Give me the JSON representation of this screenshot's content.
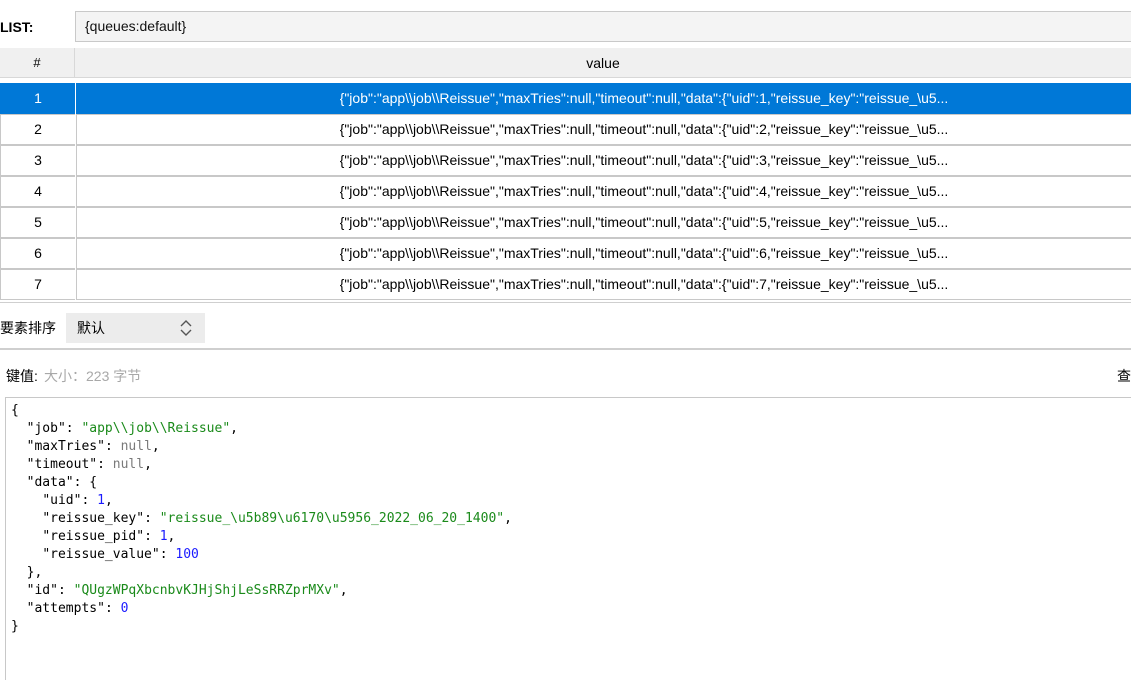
{
  "key_bar": {
    "label": "LIST:",
    "value": "{queues:default}"
  },
  "table": {
    "columns": [
      "#",
      "value"
    ],
    "rows": [
      {
        "index": "1",
        "value": "{\"job\":\"app\\\\job\\\\Reissue\",\"maxTries\":null,\"timeout\":null,\"data\":{\"uid\":1,\"reissue_key\":\"reissue_\\u5...",
        "selected": true
      },
      {
        "index": "2",
        "value": "{\"job\":\"app\\\\job\\\\Reissue\",\"maxTries\":null,\"timeout\":null,\"data\":{\"uid\":2,\"reissue_key\":\"reissue_\\u5..."
      },
      {
        "index": "3",
        "value": "{\"job\":\"app\\\\job\\\\Reissue\",\"maxTries\":null,\"timeout\":null,\"data\":{\"uid\":3,\"reissue_key\":\"reissue_\\u5..."
      },
      {
        "index": "4",
        "value": "{\"job\":\"app\\\\job\\\\Reissue\",\"maxTries\":null,\"timeout\":null,\"data\":{\"uid\":4,\"reissue_key\":\"reissue_\\u5..."
      },
      {
        "index": "5",
        "value": "{\"job\":\"app\\\\job\\\\Reissue\",\"maxTries\":null,\"timeout\":null,\"data\":{\"uid\":5,\"reissue_key\":\"reissue_\\u5..."
      },
      {
        "index": "6",
        "value": "{\"job\":\"app\\\\job\\\\Reissue\",\"maxTries\":null,\"timeout\":null,\"data\":{\"uid\":6,\"reissue_key\":\"reissue_\\u5..."
      },
      {
        "index": "7",
        "value": "{\"job\":\"app\\\\job\\\\Reissue\",\"maxTries\":null,\"timeout\":null,\"data\":{\"uid\":7,\"reissue_key\":\"reissue_\\u5..."
      }
    ],
    "selection_color": "#0078d7"
  },
  "sort": {
    "label": "要素排序",
    "selected": "默认",
    "icon": "chevron-up-down-icon"
  },
  "value_header": {
    "label": "键值:",
    "size": "大小：223 字节",
    "view_label": "查"
  },
  "json_view": {
    "open_brace": "{",
    "close_brace": "}",
    "job_key": "\"job\"",
    "job_value": "\"app\\\\job\\\\Reissue\"",
    "maxTries_key": "\"maxTries\"",
    "maxTries_value": "null",
    "timeout_key": "\"timeout\"",
    "timeout_value": "null",
    "data_key": "\"data\"",
    "data_open": "{",
    "data_close": "},",
    "uid_key": "\"uid\"",
    "uid_value": "1",
    "reissue_key_key": "\"reissue_key\"",
    "reissue_key_value": "\"reissue_\\u5b89\\u6170\\u5956_2022_06_20_1400\"",
    "reissue_pid_key": "\"reissue_pid\"",
    "reissue_pid_value": "1",
    "reissue_value_key": "\"reissue_value\"",
    "reissue_value_value": "100",
    "id_key": "\"id\"",
    "id_value": "\"QUgzWPqXbcnbvKJHjShjLeSsRRZprMXv\"",
    "attempts_key": "\"attempts\"",
    "attempts_value": "0",
    "colors": {
      "string": "#1a8a1a",
      "number": "#1a1aff",
      "null": "#7a7a7a"
    }
  }
}
